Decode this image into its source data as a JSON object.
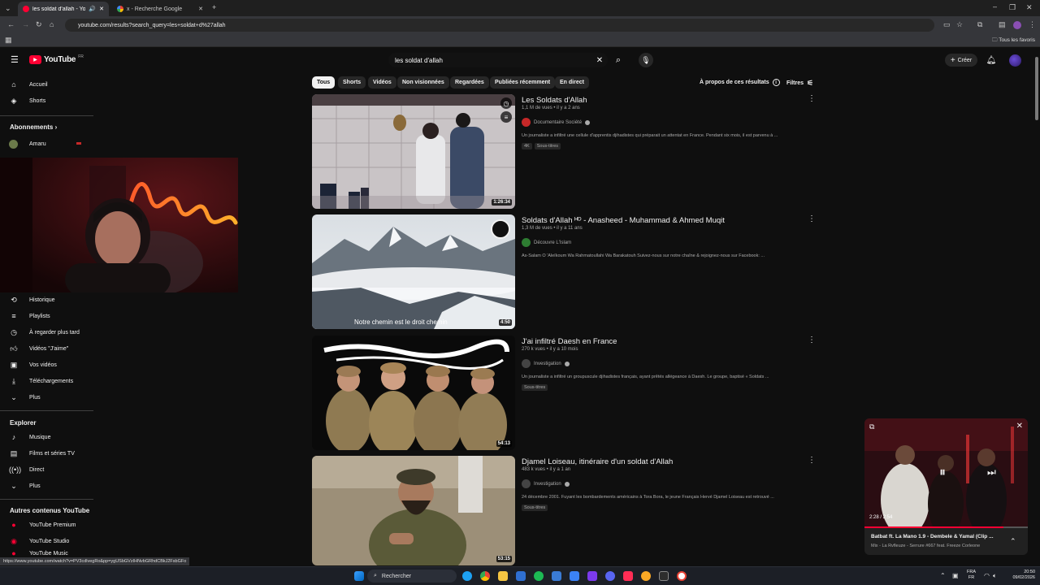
{
  "browser": {
    "tabs": [
      {
        "title": "les soldat d'allah - YouTube",
        "active": true
      },
      {
        "title": "x - Recherche Google",
        "active": false
      }
    ],
    "url": "youtube.com/results?search_query=les+soldat+d%27allah",
    "bookmarks_folder": "Tous les favoris",
    "status_url": "https://www.youtube.com/watch?v=PV3cdlvegRo&pp=ygUSbGVzIHNvbGRhdCBkJ2FsbGFo"
  },
  "youtube": {
    "logo_text": "YouTube",
    "logo_region": "FR",
    "search_value": "les soldat d'allah",
    "create_label": "Créer",
    "about_results": "À propos de ces résultats",
    "filters_label": "Filtres",
    "chips": [
      "Tous",
      "Shorts",
      "Vidéos",
      "Non visionnées",
      "Regardées",
      "Publiées récemment",
      "En direct"
    ]
  },
  "sidebar": {
    "top": [
      {
        "label": "Accueil",
        "icon": "home-icon"
      },
      {
        "label": "Shorts",
        "icon": "shorts-icon"
      }
    ],
    "subscriptions_title": "Abonnements",
    "subscriptions": [
      {
        "label": "Amaru"
      }
    ],
    "you": [
      {
        "label": "Historique",
        "icon": "history-icon"
      },
      {
        "label": "Playlists",
        "icon": "playlist-icon"
      },
      {
        "label": "À regarder plus tard",
        "icon": "clock-icon"
      },
      {
        "label": "Vidéos \"J'aime\"",
        "icon": "thumb-up-icon"
      },
      {
        "label": "Vos vidéos",
        "icon": "video-icon"
      },
      {
        "label": "Téléchargements",
        "icon": "download-icon"
      },
      {
        "label": "Plus",
        "icon": "chevron-down-icon"
      }
    ],
    "explore_title": "Explorer",
    "explore": [
      {
        "label": "Musique",
        "icon": "music-icon"
      },
      {
        "label": "Films et séries TV",
        "icon": "film-icon"
      },
      {
        "label": "Direct",
        "icon": "live-icon"
      },
      {
        "label": "Plus",
        "icon": "chevron-down-icon"
      }
    ],
    "other_title": "Autres contenus YouTube",
    "other": [
      {
        "label": "YouTube Premium"
      },
      {
        "label": "YouTube Studio"
      },
      {
        "label": "YouTube Music"
      }
    ]
  },
  "results": [
    {
      "title": "Les Soldats d'Allah",
      "meta": "1,1 M de vues • il y a 2 ans",
      "channel": "Documentaire Société",
      "channel_color": "#c62828",
      "description": "Un journaliste a infiltré une cellule d'apprentis djihadistes qui préparait un attentat en France. Pendant six mois, il est parvenu à ...",
      "badges": [
        "4K",
        "Sous-titres"
      ],
      "duration": "1:26:34"
    },
    {
      "title": "Soldats d'Allah ᴴᴰ - Anasheed - Muhammad & Ahmed Muqit",
      "meta": "1,3 M de vues • il y a 11 ans",
      "channel": "Découvre L'Islam",
      "channel_color": "#2e7d32",
      "description": "As-Salam Ô 'Aleïkoum Wa Rahmatoullahi Wa Barakatouh Suivez-nous sur notre chaîne & rejoignez-nous sur Facebook: ...",
      "badges": [],
      "duration": "4:50",
      "overlay_text": "Notre chemin est le droit chemin"
    },
    {
      "title": "J'ai infiltré Daesh en France",
      "meta": "270 k vues • il y a 10 mois",
      "channel": "Investigation",
      "channel_color": "#444444",
      "description": "Un journaliste a infiltré un groupuscule djihadistes français, ayant prêtés allégeance à Daesh. Le groupe, baptisé « Soldats ...",
      "badges": [
        "Sous-titres"
      ],
      "duration": "54:13"
    },
    {
      "title": "Djamel Loiseau, itinéraire d'un soldat d'Allah",
      "meta": "483 k vues • il y a 1 an",
      "channel": "Investigation",
      "channel_color": "#444444",
      "description": "24 décembre 2001. Fuyant les bombardements américains à Tora Bora, le jeune Français Hervé Djamel Loiseau est retrouvé ...",
      "badges": [
        "Sous-titres"
      ],
      "duration": "53:15"
    }
  ],
  "miniplayer": {
    "time": "2:28 / 2:54",
    "progress": 0.85,
    "title": "Batbat ft. La Mano 1.9 - Dembele & Yamal (Clip ...",
    "subtitle": "Mix - La Rvfleuze - Serrure #667 feat. Freeze Corleone"
  },
  "taskbar": {
    "search_label": "Rechercher",
    "lang_top": "FRA",
    "lang_bottom": "FR",
    "time": "20:50",
    "date": "09/02/2026"
  }
}
